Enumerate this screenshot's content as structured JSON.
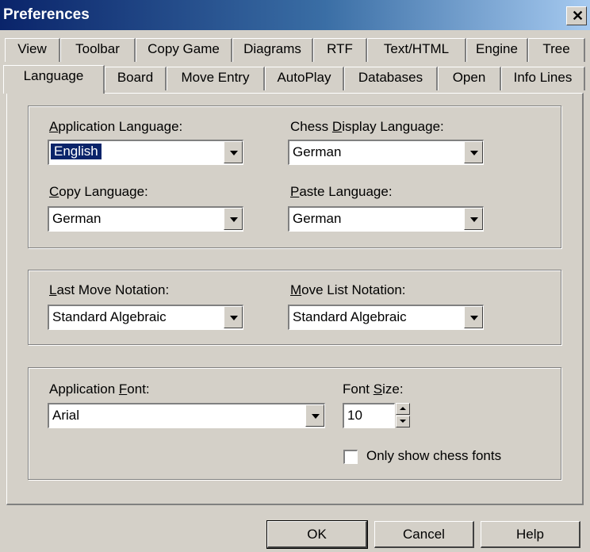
{
  "window": {
    "title": "Preferences",
    "close_glyph": "✕"
  },
  "tabs_row1": [
    "View",
    "Toolbar",
    "Copy Game",
    "Diagrams",
    "RTF",
    "Text/HTML",
    "Engine",
    "Tree"
  ],
  "tabs_row2": [
    "Language",
    "Board",
    "Move Entry",
    "AutoPlay",
    "Databases",
    "Open",
    "Info Lines"
  ],
  "active_tab": "Language",
  "language_group": {
    "app_language": {
      "label_pre": "",
      "label_u": "A",
      "label_post": "pplication Language:",
      "value": "English"
    },
    "display_language": {
      "label_pre": "Chess ",
      "label_u": "D",
      "label_post": "isplay Language:",
      "value": "German"
    },
    "copy_language": {
      "label_pre": "",
      "label_u": "C",
      "label_post": "opy Language:",
      "value": "German"
    },
    "paste_language": {
      "label_pre": "",
      "label_u": "P",
      "label_post": "aste Language:",
      "value": "German"
    }
  },
  "notation_group": {
    "last_move": {
      "label_pre": "",
      "label_u": "L",
      "label_post": "ast Move Notation:",
      "value": "Standard Algebraic"
    },
    "move_list": {
      "label_pre": "",
      "label_u": "M",
      "label_post": "ove List Notation:",
      "value": "Standard Algebraic"
    }
  },
  "font_group": {
    "app_font": {
      "label_pre": "Application ",
      "label_u": "F",
      "label_post": "ont:",
      "value": "Arial"
    },
    "font_size": {
      "label_pre": "Font ",
      "label_u": "S",
      "label_post": "ize:",
      "value": "10"
    },
    "chess_fonts_only": {
      "label": "Only show chess fonts",
      "checked": false
    }
  },
  "buttons": {
    "ok": "OK",
    "cancel": "Cancel",
    "help": "Help"
  },
  "icons": {
    "close": "close-icon",
    "dropdown": "chevron-down-icon",
    "spin_up": "spin-up-icon",
    "spin_down": "spin-down-icon"
  }
}
